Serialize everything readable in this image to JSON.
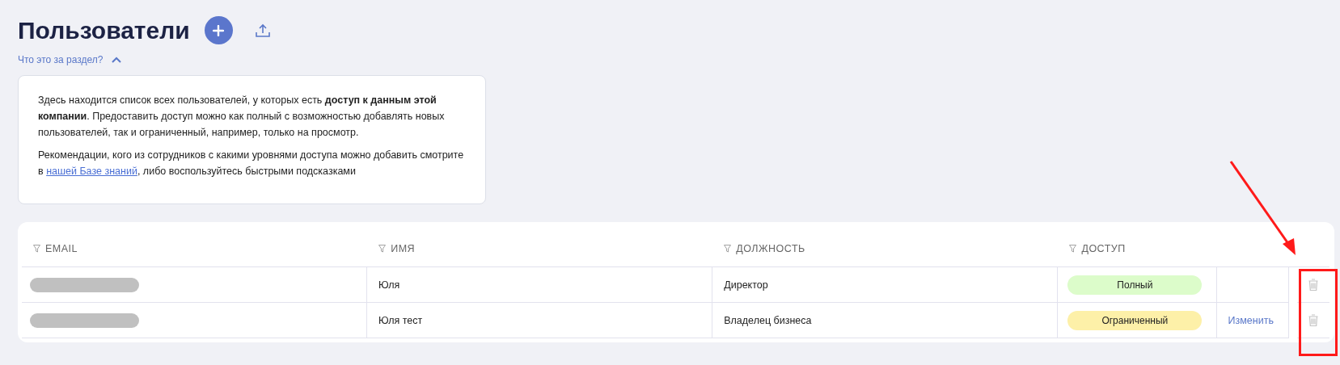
{
  "page": {
    "title": "Пользователи"
  },
  "help": {
    "toggle": "Что это за раздел?",
    "expanded": true,
    "paragraph_1": "Здесь находится список всех пользователей, у которых есть **доступ к данным этой компании**. Предоставить доступ можно как полный с возможностью добавлять новых пользователей, так и ограниченный, например, только на просмотр.",
    "paragraph_2": {
      "before": "Рекомендации, кого из сотрудников с какими уровнями доступа можно добавить смотрите в ",
      "link": "нашей Базе знаний",
      "after": ", либо воспользуйтесь быстрыми подсказками"
    }
  },
  "table": {
    "columns": [
      "EMAIL",
      "ИМЯ",
      "ДОЛЖНОСТЬ",
      "ДОСТУП"
    ],
    "rows": [
      {
        "name": "Юля",
        "position": "Директор",
        "access": "Полный",
        "color": "#dcfcca"
      },
      {
        "name": "Юля тест",
        "position": "Владелец бизнеса",
        "access": "Ограниченный",
        "color": "#fdf0a8",
        "action": "Изменить"
      }
    ]
  }
}
